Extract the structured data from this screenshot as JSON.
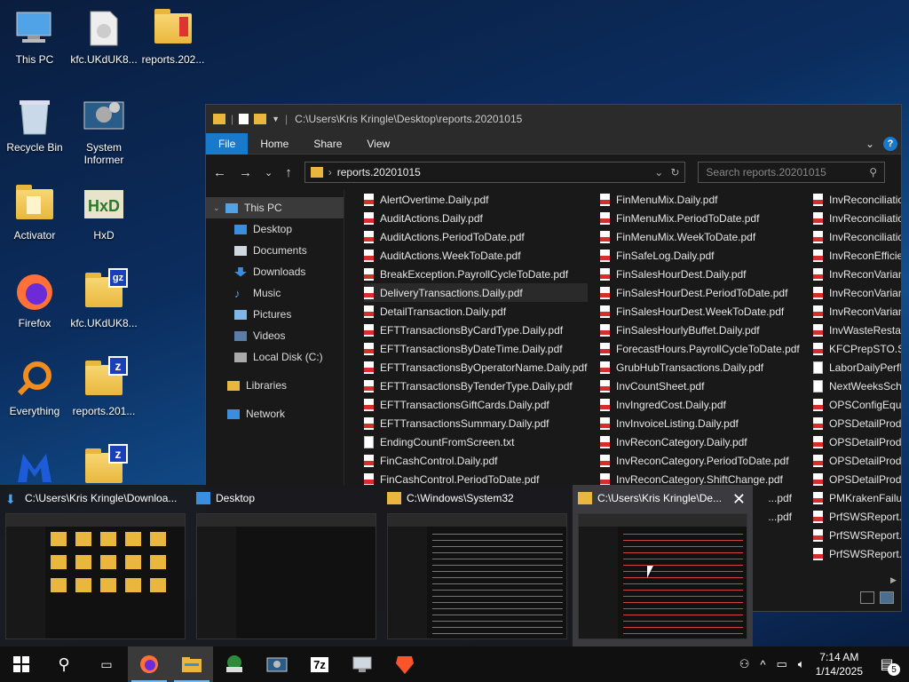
{
  "desktop": {
    "icons": [
      {
        "label": "This PC",
        "icon": "this-pc-icon"
      },
      {
        "label": "kfc.UKdUK8...",
        "icon": "file-icon"
      },
      {
        "label": "reports.202...",
        "icon": "zip-folder-icon"
      },
      {
        "label": "Recycle Bin",
        "icon": "recycle-bin-icon"
      },
      {
        "label": "System Informer",
        "icon": "system-informer-icon"
      },
      {
        "label": "Activator",
        "icon": "folder-icon"
      },
      {
        "label": "HxD",
        "icon": "hxd-icon"
      },
      {
        "label": "Firefox",
        "icon": "firefox-icon"
      },
      {
        "label": "kfc.UKdUK8...",
        "icon": "gz-archive-icon"
      },
      {
        "label": "Everything",
        "icon": "everything-icon"
      },
      {
        "label": "reports.201...",
        "icon": "zip-archive-icon"
      },
      {
        "label": "",
        "icon": "malwarebytes-icon"
      },
      {
        "label": "",
        "icon": "zip-archive-icon"
      }
    ]
  },
  "explorer": {
    "title_path": "C:\\Users\\Kris Kringle\\Desktop\\reports.20201015",
    "ribbon_tabs": [
      "File",
      "Home",
      "Share",
      "View"
    ],
    "address": "reports.20201015",
    "search_placeholder": "Search reports.20201015",
    "nav": [
      {
        "label": "This PC",
        "icon": "this-pc-icon",
        "indent": 0,
        "selected": true
      },
      {
        "label": "Desktop",
        "icon": "desktop-icon",
        "indent": 1
      },
      {
        "label": "Documents",
        "icon": "documents-icon",
        "indent": 1
      },
      {
        "label": "Downloads",
        "icon": "downloads-icon",
        "indent": 1
      },
      {
        "label": "Music",
        "icon": "music-icon",
        "indent": 1
      },
      {
        "label": "Pictures",
        "icon": "pictures-icon",
        "indent": 1
      },
      {
        "label": "Videos",
        "icon": "videos-icon",
        "indent": 1
      },
      {
        "label": "Local Disk (C:)",
        "icon": "disk-icon",
        "indent": 1
      },
      {
        "label": "Libraries",
        "icon": "libraries-icon",
        "indent": 0
      },
      {
        "label": "Network",
        "icon": "network-icon",
        "indent": 0
      }
    ],
    "files_col1": [
      "AlertOvertime.Daily.pdf",
      "AuditActions.Daily.pdf",
      "AuditActions.PeriodToDate.pdf",
      "AuditActions.WeekToDate.pdf",
      "BreakException.PayrollCycleToDate.pdf",
      "DeliveryTransactions.Daily.pdf",
      "DetailTransaction.Daily.pdf",
      "EFTTransactionsByCardType.Daily.pdf",
      "EFTTransactionsByDateTime.Daily.pdf",
      "EFTTransactionsByOperatorName.Daily.pdf",
      "EFTTransactionsByTenderType.Daily.pdf",
      "EFTTransactionsGiftCards.Daily.pdf",
      "EFTTransactionsSummary.Daily.pdf",
      "EndingCountFromScreen.txt",
      "FinCashControl.Daily.pdf",
      "FinCashControl.PeriodToDate.pdf"
    ],
    "files_col2": [
      "FinMenuMix.Daily.pdf",
      "FinMenuMix.PeriodToDate.pdf",
      "FinMenuMix.WeekToDate.pdf",
      "FinSafeLog.Daily.pdf",
      "FinSalesHourDest.Daily.pdf",
      "FinSalesHourDest.PeriodToDate.pdf",
      "FinSalesHourDest.WeekToDate.pdf",
      "FinSalesHourlyBuffet.Daily.pdf",
      "ForecastHours.PayrollCycleToDate.pdf",
      "GrubHubTransactions.Daily.pdf",
      "InvCountSheet.pdf",
      "InvIngredCost.Daily.pdf",
      "InvInvoiceListing.Daily.pdf",
      "InvReconCategory.Daily.pdf",
      "InvReconCategory.PeriodToDate.pdf",
      "InvReconCategory.ShiftChange.pdf"
    ],
    "files_col3": [
      "InvReconciliatio",
      "InvReconciliatio",
      "InvReconciliatio",
      "InvReconEfficien",
      "InvReconVarianc",
      "InvReconVarianc",
      "InvReconVarianc",
      "InvWasteRestag",
      "KFCPrepSTO.Sta",
      "LaborDailyPerfD",
      "NextWeeksSche",
      "OPSConfigEquip",
      "OPSDetailProdu",
      "OPSDetailProdu",
      "OPSDetailProdu",
      "OPSDetailProdu",
      "PMKrakenFailur",
      "PrfSWSReport.D",
      "PrfSWSReport.P",
      "PrfSWSReport.W"
    ],
    "col2_partial": [
      "...pdf",
      "...pdf"
    ]
  },
  "switcher": {
    "windows": [
      {
        "title": "C:\\Users\\Kris Kringle\\Downloa...",
        "icon": "download-arrow-icon"
      },
      {
        "title": "Desktop",
        "icon": "desktop-icon"
      },
      {
        "title": "C:\\Windows\\System32",
        "icon": "folder-icon"
      },
      {
        "title": "C:\\Users\\Kris Kringle\\De...",
        "icon": "folder-icon"
      }
    ]
  },
  "taskbar": {
    "apps": [
      "start-icon",
      "search-icon",
      "task-view-icon",
      "firefox-icon",
      "file-explorer-icon",
      "network-app-icon",
      "system-informer-icon",
      "7zip-icon",
      "remote-desktop-icon",
      "brave-icon"
    ],
    "time": "7:14 AM",
    "date": "1/14/2025",
    "notification_count": "5",
    "sevenzip_label": "7z"
  }
}
